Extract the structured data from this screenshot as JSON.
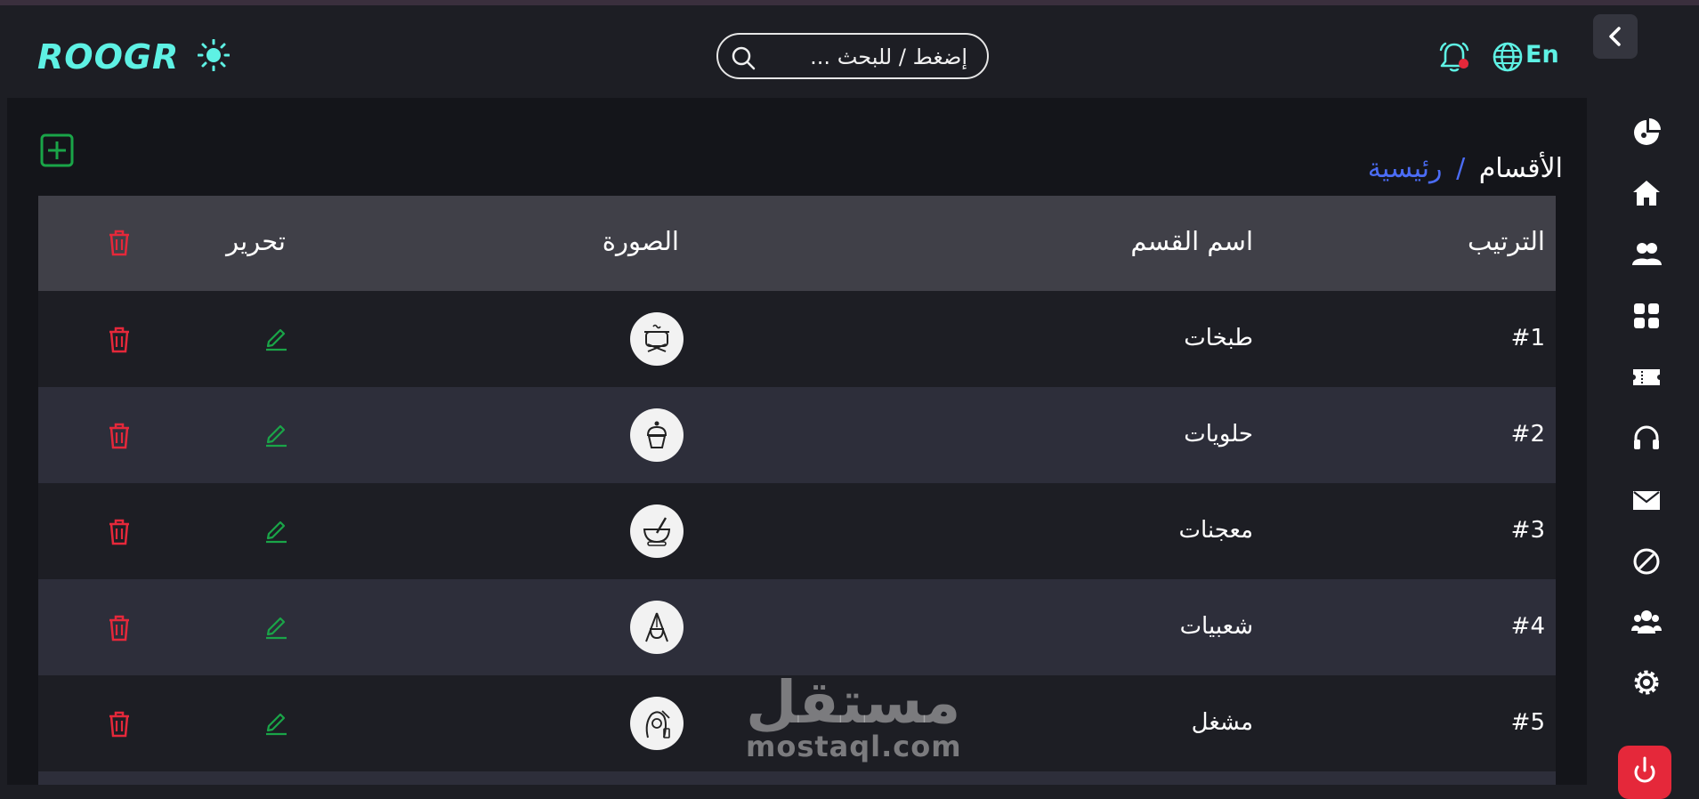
{
  "header": {
    "logo": "ROOGR",
    "search_placeholder": "إضغط / للبحث ...",
    "language": "En"
  },
  "breadcrumb": {
    "current": "الأقسام",
    "separator": "/",
    "home": "رئيسية"
  },
  "table": {
    "columns": {
      "order": "الترتيب",
      "name": "اسم القسم",
      "image": "الصورة",
      "edit": "تحرير"
    },
    "rows": [
      {
        "order": "#1",
        "name": "طبخات",
        "icon": "cooking-pot-icon"
      },
      {
        "order": "#2",
        "name": "حلويات",
        "icon": "cupcake-icon"
      },
      {
        "order": "#3",
        "name": "معجنات",
        "icon": "mixing-bowl-icon"
      },
      {
        "order": "#4",
        "name": "شعبيات",
        "icon": "tripod-pot-icon"
      },
      {
        "order": "#5",
        "name": "مشغل",
        "icon": "salon-icon"
      }
    ]
  },
  "sidebar": {
    "items": [
      "chart-icon",
      "home-icon",
      "users-icon",
      "grid-icon",
      "ticket-icon",
      "headset-icon",
      "mail-icon",
      "block-icon",
      "group-icon",
      "settings-icon",
      "power-icon"
    ]
  },
  "watermark": {
    "arabic": "مستقل",
    "latin": "mostaql.com"
  },
  "colors": {
    "accent": "#5ef1e4",
    "link": "#4b6cf5",
    "edit": "#1aa548",
    "delete": "#e5283a"
  }
}
